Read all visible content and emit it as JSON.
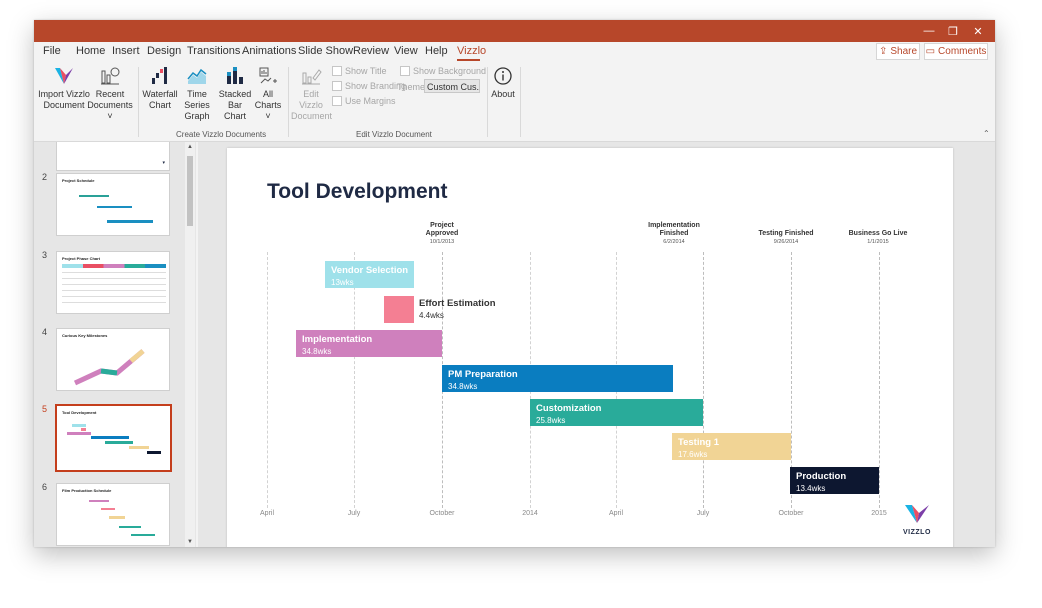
{
  "window": {
    "minimize": "—",
    "restore": "❐",
    "close": "✕"
  },
  "menu": [
    "File",
    "Home",
    "Insert",
    "Design",
    "Transitions",
    "Animations",
    "Slide Show",
    "Review",
    "View",
    "Help",
    "Vizzlo"
  ],
  "header": {
    "share": "Share",
    "comments": "Comments"
  },
  "ribbon": {
    "import": "Import Vizzlo Document",
    "import_l1": "Import Vizzlo",
    "import_l2": "Document",
    "recent_l1": "Recent",
    "recent_l2": "Documents ˅",
    "waterfall_l1": "Waterfall",
    "waterfall_l2": "Chart",
    "timeseries_l1": "Time Series",
    "timeseries_l2": "Graph",
    "stacked_l1": "Stacked",
    "stacked_l2": "Bar Chart",
    "allcharts_l1": "All Charts",
    "allcharts_l2": "˅",
    "edit_l1": "Edit Vizzlo",
    "edit_l2": "Document",
    "show_title": "Show Title",
    "show_branding": "Show Branding",
    "use_margins": "Use Margins",
    "show_background": "Show Background",
    "theme_label": "Theme",
    "theme_value": "Custom Cus...",
    "about": "About",
    "group_create": "Create Vizzlo Documents",
    "group_edit": "Edit Vizzlo Document"
  },
  "thumbnails": [
    {
      "num": "2",
      "title": "Project Schedule"
    },
    {
      "num": "3",
      "title": "Project Phase Chart"
    },
    {
      "num": "4",
      "title": "Curious Key Milestones"
    },
    {
      "num": "5",
      "title": "Tool Development"
    },
    {
      "num": "6",
      "title": "Film Production Schedule"
    }
  ],
  "slide": {
    "title": "Tool Development",
    "logo": "VIZZLO",
    "milestones": [
      {
        "l1": "Project",
        "l2": "Approved",
        "date": "10/1/2013"
      },
      {
        "l1": "Implementation",
        "l2": "Finished",
        "date": "6/2/2014"
      },
      {
        "l1": "Testing Finished",
        "l2": "",
        "date": "9/26/2014"
      },
      {
        "l1": "Business Go Live",
        "l2": "",
        "date": "1/1/2015"
      }
    ],
    "ticks": [
      "April",
      "July",
      "October",
      "2014",
      "April",
      "July",
      "October",
      "2015"
    ]
  },
  "chart_data": {
    "type": "gantt",
    "title": "Tool Development",
    "tasks": [
      {
        "name": "Vendor Selection",
        "duration": "13wks",
        "color": "#9fe1ea"
      },
      {
        "name": "Effort Estimation",
        "duration": "4.4wks",
        "color": "#f47f93"
      },
      {
        "name": "Implementation",
        "duration": "34.8wks",
        "color": "#cf80bd"
      },
      {
        "name": "PM Preparation",
        "duration": "34.8wks",
        "color": "#0a7dc0"
      },
      {
        "name": "Customization",
        "duration": "25.8wks",
        "color": "#29ab9a"
      },
      {
        "name": "Testing 1",
        "duration": "17.6wks",
        "color": "#f1d495"
      },
      {
        "name": "Production",
        "duration": "13.4wks",
        "color": "#0d1730"
      }
    ],
    "x_ticks": [
      "April",
      "July",
      "October",
      "2014",
      "April",
      "July",
      "October",
      "2015"
    ],
    "milestones": [
      {
        "name": "Project Approved",
        "date": "10/1/2013"
      },
      {
        "name": "Implementation Finished",
        "date": "6/2/2014"
      },
      {
        "name": "Testing Finished",
        "date": "9/26/2014"
      },
      {
        "name": "Business Go Live",
        "date": "1/1/2015"
      }
    ]
  }
}
